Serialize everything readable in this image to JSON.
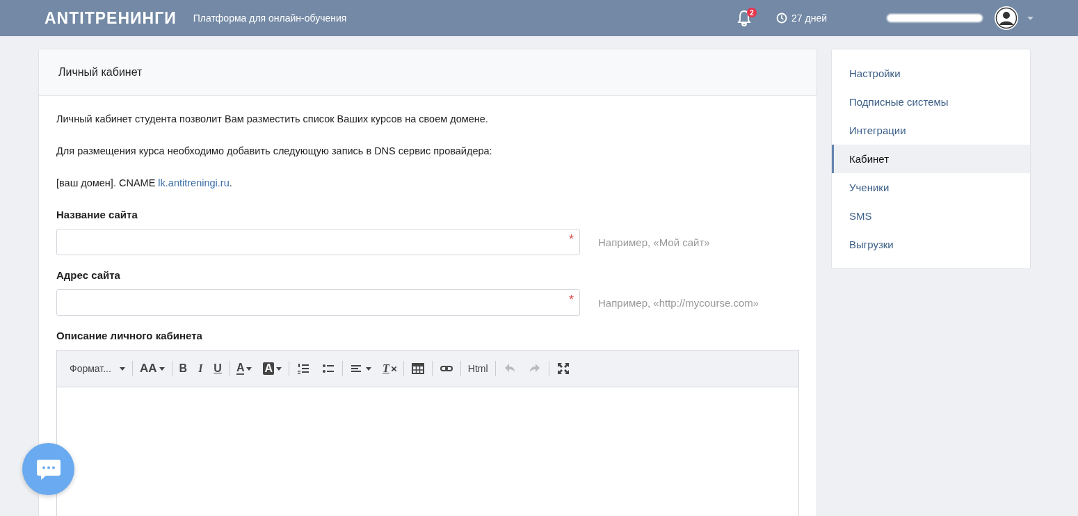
{
  "header": {
    "logo": "ANTIТРЕНИНГИ",
    "tagline": "Платформа для онлайн-обучения",
    "notifications_badge": "2",
    "trial": "27 дней"
  },
  "card": {
    "title": "Личный кабинет",
    "paragraphs": [
      {
        "text": "Личный кабинет студента позволит Вам разместить список Ваших курсов на своем домене."
      },
      {
        "text": "Для размещения курса необходимо добавить следующую запись в DNS сервис провайдера:"
      },
      {
        "text": "[ваш домен]. CNAME ",
        "link": "lk.antitreningi.ru",
        "after": "."
      }
    ],
    "fields": [
      {
        "label": "Название сайта",
        "required_mark": "*",
        "hint": "Например, «Мой сайт»"
      },
      {
        "label": "Адрес сайта",
        "required_mark": "*",
        "hint": "Например, «http://mycourse.com»"
      }
    ],
    "editor": {
      "label": "Описание личного кабинета",
      "toolbar": [
        {
          "kind": "format",
          "label": "Формат...",
          "disabled": false
        },
        {
          "kind": "sep"
        },
        {
          "kind": "fontsize",
          "label": "AA",
          "disabled": false
        },
        {
          "kind": "sep"
        },
        {
          "kind": "bold",
          "label": "B",
          "disabled": false
        },
        {
          "kind": "italic",
          "label": "I",
          "disabled": false
        },
        {
          "kind": "underline",
          "label": "U",
          "disabled": false
        },
        {
          "kind": "sep"
        },
        {
          "kind": "forecolor",
          "label": "A",
          "disabled": false
        },
        {
          "kind": "backcolor",
          "label": "A",
          "disabled": false
        },
        {
          "kind": "sep"
        },
        {
          "kind": "ol",
          "disabled": false
        },
        {
          "kind": "ul",
          "disabled": false
        },
        {
          "kind": "sep"
        },
        {
          "kind": "align",
          "disabled": false
        },
        {
          "kind": "clear",
          "label": "T",
          "disabled": false
        },
        {
          "kind": "sep"
        },
        {
          "kind": "table",
          "disabled": false
        },
        {
          "kind": "sep"
        },
        {
          "kind": "link",
          "disabled": false
        },
        {
          "kind": "sep"
        },
        {
          "kind": "html",
          "label": "Html",
          "disabled": false
        },
        {
          "kind": "sep"
        },
        {
          "kind": "undo",
          "disabled": true
        },
        {
          "kind": "redo",
          "disabled": true
        },
        {
          "kind": "sep"
        },
        {
          "kind": "fullscreen",
          "disabled": false
        }
      ]
    }
  },
  "sidebar": {
    "items": [
      {
        "label": "Настройки",
        "selected": false
      },
      {
        "label": "Подписные системы",
        "selected": false
      },
      {
        "label": "Интеграции",
        "selected": false
      },
      {
        "label": "Кабинет",
        "selected": true
      },
      {
        "label": "Ученики",
        "selected": false
      },
      {
        "label": "SMS",
        "selected": false
      },
      {
        "label": "Выгрузки",
        "selected": false
      }
    ]
  }
}
